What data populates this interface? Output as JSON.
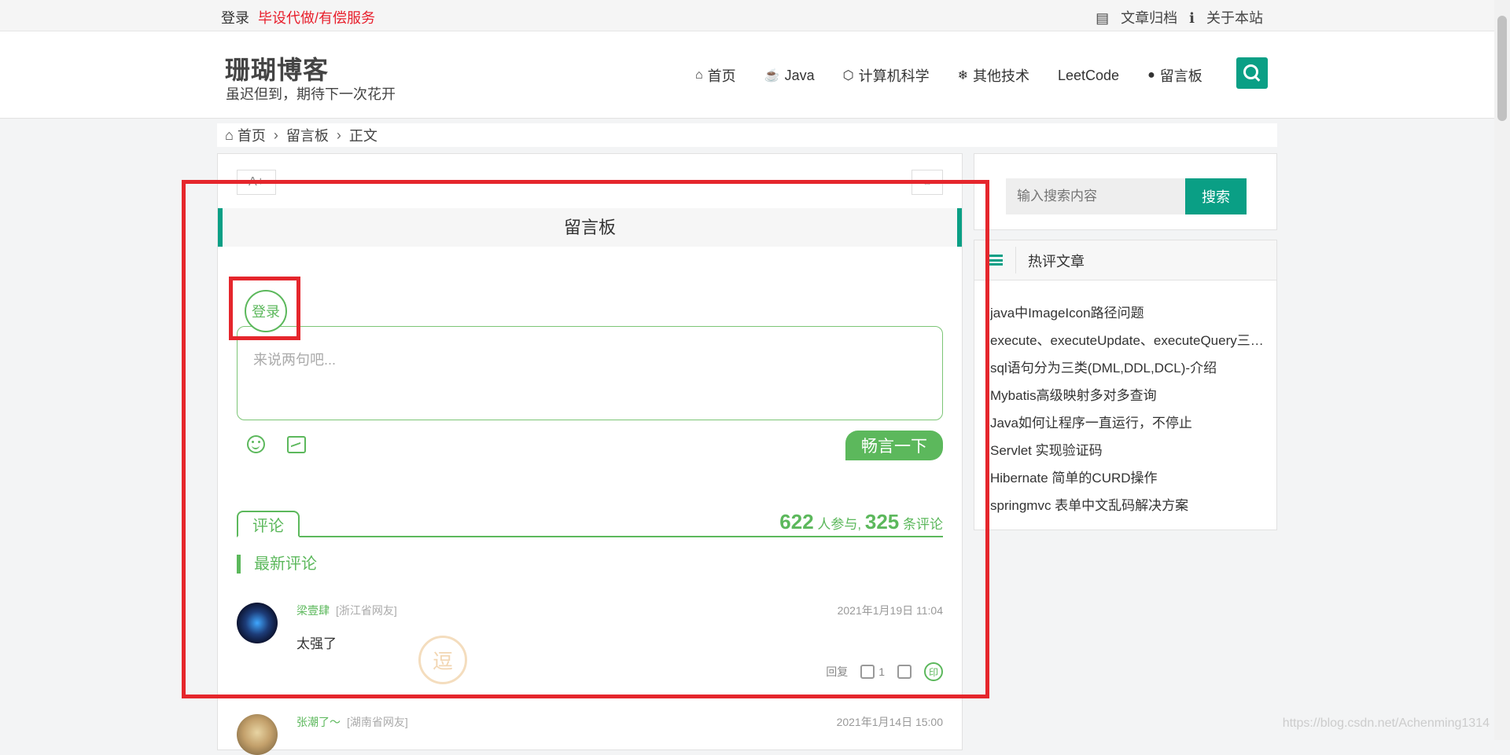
{
  "topbar": {
    "login": "登录",
    "promo": "毕设代做/有偿服务",
    "archive": "文章归档",
    "about": "关于本站"
  },
  "header": {
    "logo": "珊瑚博客",
    "slogan": "虽迟但到，期待下一次花开",
    "nav": [
      {
        "label": "首页",
        "icon": "home-icon"
      },
      {
        "label": "Java",
        "icon": "coffee-icon"
      },
      {
        "label": "计算机科学",
        "icon": "cubes-icon"
      },
      {
        "label": "其他技术",
        "icon": "snowflake-icon"
      },
      {
        "label": "LeetCode",
        "icon": ""
      },
      {
        "label": "留言板",
        "icon": "comment-icon"
      }
    ]
  },
  "breadcrumb": {
    "home": "首页",
    "board": "留言板",
    "current": "正文"
  },
  "article": {
    "font_btn": "A+",
    "expand_btn": "⇔",
    "title": "留言板",
    "login_avatar": "登录",
    "placeholder": "来说两句吧...",
    "submit": "畅言一下",
    "tab": "评论",
    "stats": {
      "participants": "622",
      "participants_label": "人参与,",
      "comments": "325",
      "comments_label": "条评论"
    },
    "latest": "最新评论"
  },
  "comments": [
    {
      "name": "梁壹肆",
      "place": "[浙江省网友]",
      "time": "2021年1月19日 11:04",
      "text": "太强了",
      "reply": "回复",
      "likes": "1"
    },
    {
      "name": "张潮了～",
      "place": "[湖南省网友]",
      "time": "2021年1月14日 15:00",
      "text": "",
      "reply": "",
      "likes": ""
    }
  ],
  "sidebar": {
    "search_placeholder": "输入搜索内容",
    "search_btn": "搜索",
    "hot_title": "热评文章",
    "hot_items": [
      "java中ImageIcon路径问题",
      "execute、executeUpdate、executeQuery三者的区别",
      "sql语句分为三类(DML,DDL,DCL)-介绍",
      "Mybatis高级映射多对多查询",
      "Java如何让程序一直运行，不停止",
      "Servlet 实现验证码",
      "Hibernate 简单的CURD操作",
      "springmvc 表单中文乱码解决方案"
    ]
  },
  "watermark": "https://blog.csdn.net/Achenming1314",
  "stamp": "逗",
  "colors": {
    "accent": "#0a9f85",
    "green": "#5cb85c",
    "annotation_red": "#e5262c"
  }
}
